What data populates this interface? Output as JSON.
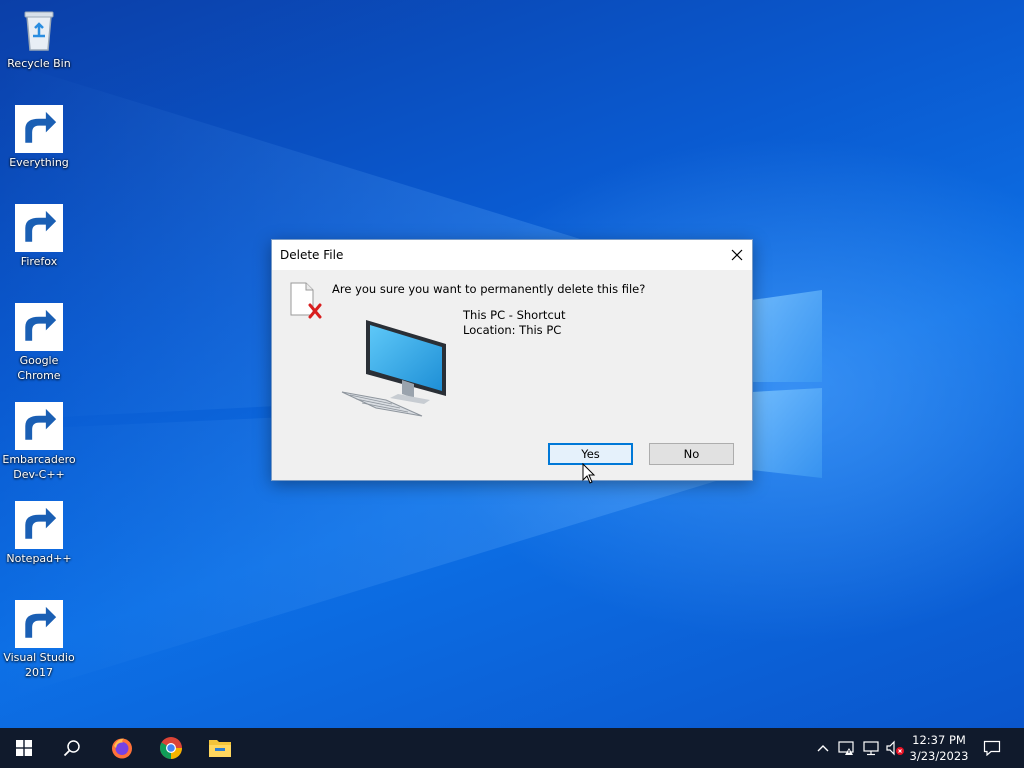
{
  "desktop": {
    "icons": [
      {
        "label": "Recycle Bin",
        "icon": "recycle-bin-icon",
        "shortcut": false
      },
      {
        "label": "Everything",
        "icon": "everything-search-icon",
        "shortcut": true
      },
      {
        "label": "Firefox",
        "icon": "firefox-icon",
        "shortcut": true
      },
      {
        "label": "Google\nChrome",
        "icon": "chrome-icon",
        "shortcut": true
      },
      {
        "label": "Embarcadero\nDev-C++",
        "icon": "devcpp-icon",
        "shortcut": true
      },
      {
        "label": "Notepad++",
        "icon": "notepadpp-icon",
        "shortcut": true
      },
      {
        "label": "Visual Studio\n2017",
        "icon": "visual-studio-icon",
        "shortcut": true
      }
    ]
  },
  "dialog": {
    "title": "Delete File",
    "question": "Are you sure you want to permanently delete this file?",
    "file_name": "This PC - Shortcut",
    "file_location": "Location: This PC",
    "yes_label": "Yes",
    "no_label": "No"
  },
  "taskbar": {
    "pinned": [
      "start-icon",
      "search-icon",
      "firefox-icon",
      "chrome-icon",
      "file-explorer-icon"
    ],
    "tray": [
      "chevron-up-icon",
      "network-warning-icon",
      "network-icon",
      "volume-muted-icon"
    ],
    "time": "12:37 PM",
    "date": "3/23/2023"
  },
  "colors": {
    "accent": "#0078d7",
    "taskbar": "#101a2c",
    "dialog_bg": "#f0f0f0"
  }
}
